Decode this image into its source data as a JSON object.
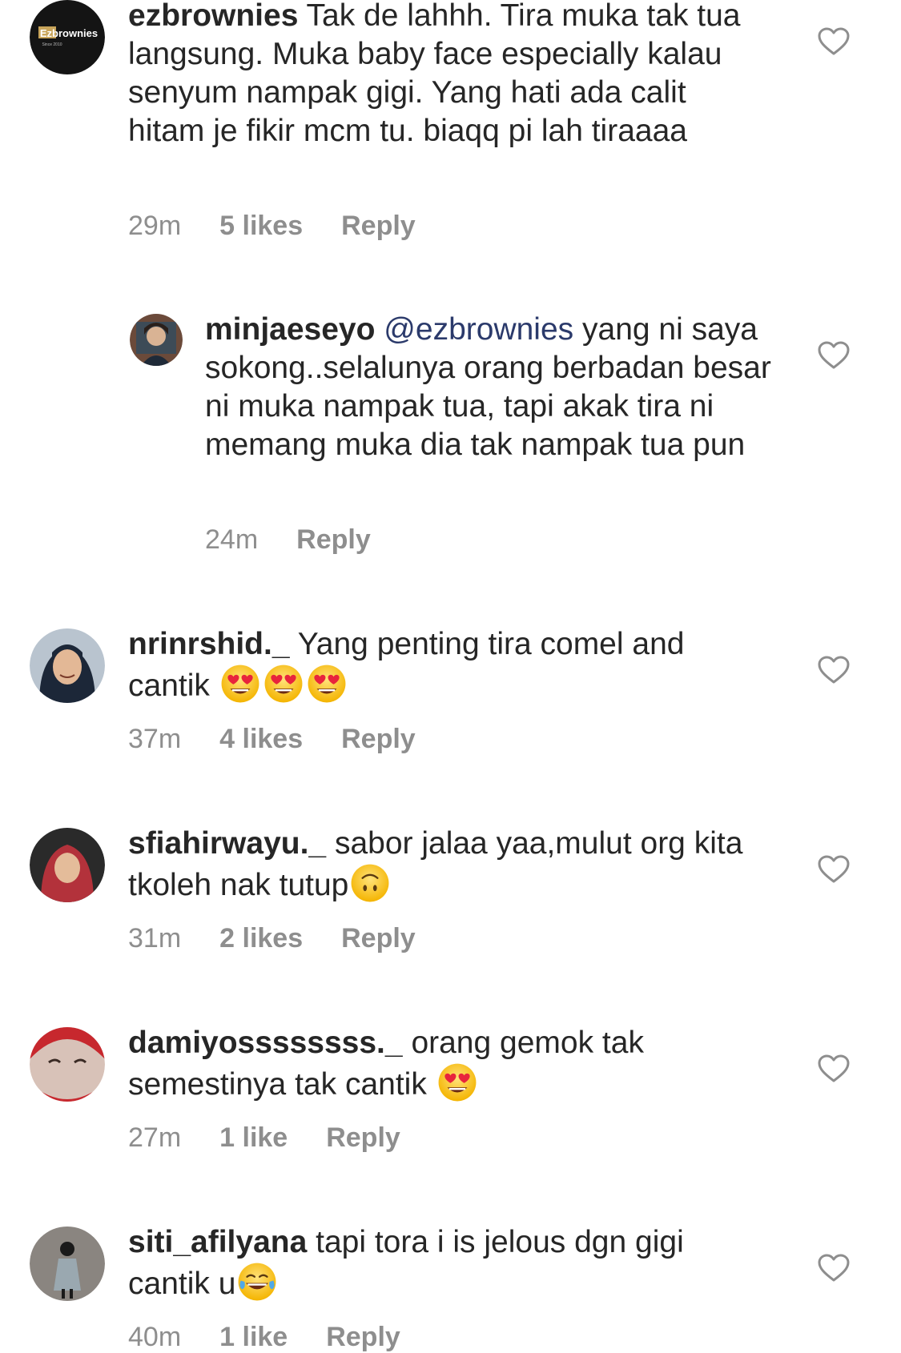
{
  "comments": [
    {
      "username": "ezbrownies",
      "text": "Tak de lahhh. Tira muka tak tua langsung. Muka baby face especially kalau senyum nampak gigi. Yang hati ada calit hitam je fikir mcm tu. biaqq pi lah tiraaaa",
      "time": "29m",
      "likes": "5 likes",
      "reply_label": "Reply",
      "avatar_logo": "Ezbrownies",
      "avatar_tagline": "Since 2010"
    },
    {
      "username": "minjaeseyo",
      "mention": "@ezbrownies",
      "text": "yang ni saya sokong..selalunya orang berbadan besar ni muka nampak tua, tapi akak tira ni memang muka dia tak nampak tua pun",
      "time": "24m",
      "reply_label": "Reply"
    },
    {
      "username": "nrinrshid._",
      "text": "Yang penting tira comel and cantik",
      "emojis": [
        "heart-eyes",
        "heart-eyes",
        "heart-eyes"
      ],
      "time": "37m",
      "likes": "4 likes",
      "reply_label": "Reply"
    },
    {
      "username": "sfiahirwayu._",
      "text": "sabor jalaa yaa,mulut org kita tkoleh nak tutup",
      "emojis": [
        "upside-down-face"
      ],
      "time": "31m",
      "likes": "2 likes",
      "reply_label": "Reply"
    },
    {
      "username": "damiyossssssss._",
      "text": "orang gemok tak semestinya tak cantik",
      "emojis": [
        "heart-eyes"
      ],
      "time": "27m",
      "likes": "1 like",
      "reply_label": "Reply"
    },
    {
      "username": "siti_afilyana",
      "text": "tapi tora i is jelous dgn gigi cantik u",
      "emojis": [
        "tears-of-joy"
      ],
      "time": "40m",
      "likes": "1 like",
      "reply_label": "Reply"
    }
  ],
  "colors": {
    "text": "#262626",
    "secondary": "#8e8e8e",
    "mention": "#2b3a6b",
    "heart_outline": "#8e8e8e"
  },
  "icons": {
    "like": "heart-outline-icon"
  }
}
